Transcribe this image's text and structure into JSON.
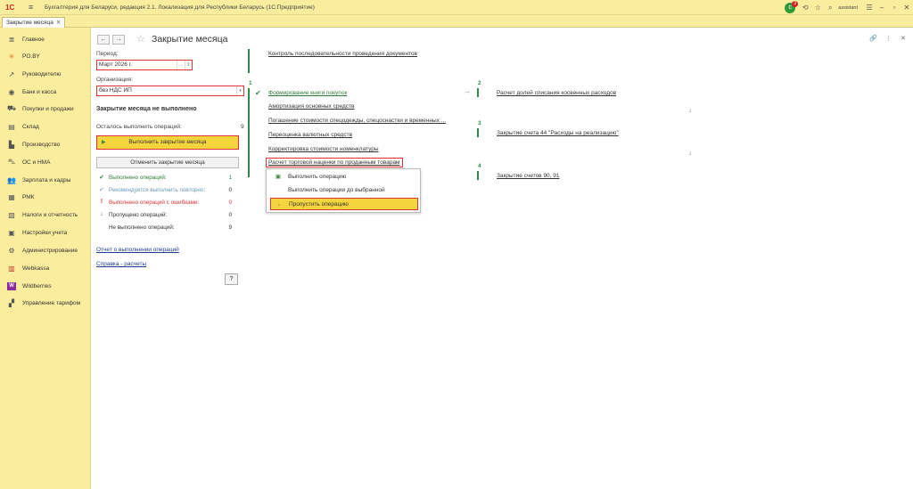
{
  "titlebar": {
    "logo": "1С",
    "title": "Бухгалтерия для Беларуси, редакция 2.1. Локализация для Республики Беларусь  (1С:Предприятие)",
    "notif_count": "3",
    "user": "assistant"
  },
  "tab": {
    "label": "Закрытие месяца"
  },
  "sidebar": {
    "items": [
      {
        "label": "Главное",
        "icon": "hamburger-icon"
      },
      {
        "label": "PO.BY",
        "icon": "asterisk-icon"
      },
      {
        "label": "Руководителю",
        "icon": "trend-icon"
      },
      {
        "label": "Банк и касса",
        "icon": "bank-icon"
      },
      {
        "label": "Покупки и продажи",
        "icon": "cart-icon"
      },
      {
        "label": "Склад",
        "icon": "warehouse-icon"
      },
      {
        "label": "Производство",
        "icon": "factory-icon"
      },
      {
        "label": "ОС и НМА",
        "icon": "car-icon"
      },
      {
        "label": "Зарплата и кадры",
        "icon": "people-icon"
      },
      {
        "label": "РМК",
        "icon": "register-icon"
      },
      {
        "label": "Налоги и отчетность",
        "icon": "tax-icon"
      },
      {
        "label": "Настройки учета",
        "icon": "settings-icon"
      },
      {
        "label": "Администрирование",
        "icon": "gear-icon"
      },
      {
        "label": "Webkassa",
        "icon": "webkassa-icon"
      },
      {
        "label": "Wildberries",
        "icon": "wildberries-icon"
      },
      {
        "label": "Управление тарифом",
        "icon": "tariff-icon"
      }
    ]
  },
  "page": {
    "title": "Закрытие месяца",
    "period_label": "Период:",
    "period_value": "Март 2026 г.",
    "org_label": "Организация:",
    "org_value": "без НДС ИП",
    "status_title": "Закрытие месяца не выполнено",
    "remaining_label": "Осталось выполнить операций:",
    "remaining_value": "9",
    "run_button": "Выполнить закрытие месяца",
    "cancel_button": "Отменить закрытие месяца",
    "stats": [
      {
        "label": "Выполнено операций:",
        "value": "1",
        "color": "#2f7a3a",
        "icon": "check-icon"
      },
      {
        "label": "Рекомендуется выполнить повторно:",
        "value": "0",
        "color": "#6a9ab8",
        "icon": "check-icon"
      },
      {
        "label": "Выполнено операций с ошибками:",
        "value": "0",
        "color": "#d33333",
        "icon": "error-icon"
      },
      {
        "label": "Пропущено операций:",
        "value": "0",
        "color": "#333333",
        "icon": "skip-icon"
      },
      {
        "label": "Не выполнено операций:",
        "value": "9",
        "color": "#333333",
        "icon": "none"
      }
    ],
    "report_link": "Отчет о выполнении операций",
    "help_link": "Справка - расчеты",
    "help_button": "?"
  },
  "ops": {
    "top": "Контроль последовательности проведения документов",
    "g1": [
      "Формирование книги покупок",
      "Амортизация основных средств",
      "Погашение стоимости спецодежды, спецоснастки и временных ...",
      "Переоценка валютных средств",
      "Корректировка стоимости номенклатуры",
      "Расчет торговой наценки по проданным товарам"
    ],
    "g2": [
      "Расчет долей списания косвенных расходов"
    ],
    "g3": [
      "Закрытие счета 44 \"Расходы на реализацию\""
    ],
    "g4": [
      "Закрытие счетов 90, 91"
    ],
    "group_numbers": [
      "1",
      "2",
      "3",
      "4"
    ]
  },
  "context_menu": [
    "Выполнить операцию",
    "Выполнить операции до выбранной",
    "Пропустить операцию"
  ],
  "colors": {
    "accent": "#f5d53e",
    "panel": "#fbed9e",
    "green": "#2f8a4a",
    "error": "#d33333"
  }
}
